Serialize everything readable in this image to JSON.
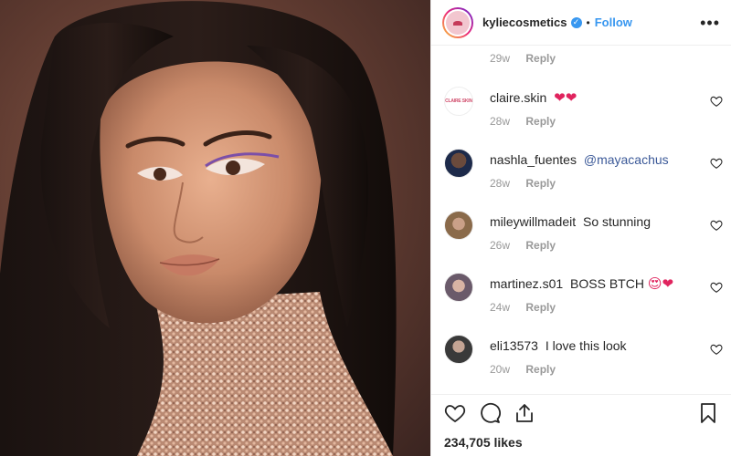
{
  "post": {
    "photo_alt": "",
    "header": {
      "username": "kyliecosmetics",
      "separator": "•",
      "follow_label": "Follow",
      "more_label": "•••"
    },
    "top_meta": {
      "time": "29w",
      "reply": "Reply"
    },
    "comments": [
      {
        "user": "claire.skin",
        "text": "",
        "emoji": "❤❤",
        "mention": "",
        "time": "28w",
        "reply": "Reply",
        "avatar": "claire-skin-logo"
      },
      {
        "user": "nashla_fuentes",
        "text": "",
        "emoji": "",
        "mention": "@mayacachus",
        "time": "28w",
        "reply": "Reply",
        "avatar": "user-photo"
      },
      {
        "user": "mileywillmadeit",
        "text": "So stunning",
        "emoji": "",
        "mention": "",
        "time": "26w",
        "reply": "Reply",
        "avatar": "user-photo"
      },
      {
        "user": "martinez.s01",
        "text": "BOSS BTCH",
        "emoji": "😍❤",
        "mention": "",
        "time": "24w",
        "reply": "Reply",
        "avatar": "user-photo"
      },
      {
        "user": "eli13573",
        "text": "I love this look",
        "emoji": "",
        "mention": "",
        "time": "20w",
        "reply": "Reply",
        "avatar": "user-photo"
      }
    ],
    "avatar_logo_text": "CLAIRE SKIN",
    "likes_label": "234,705 likes",
    "icons": [
      "heart-icon",
      "comment-icon",
      "share-icon",
      "bookmark-icon",
      "verified-badge-icon",
      "more-options-icon"
    ],
    "colors": {
      "link": "#3897f0",
      "text": "#262626",
      "muted": "#999999",
      "heart": "#e0245e"
    }
  }
}
